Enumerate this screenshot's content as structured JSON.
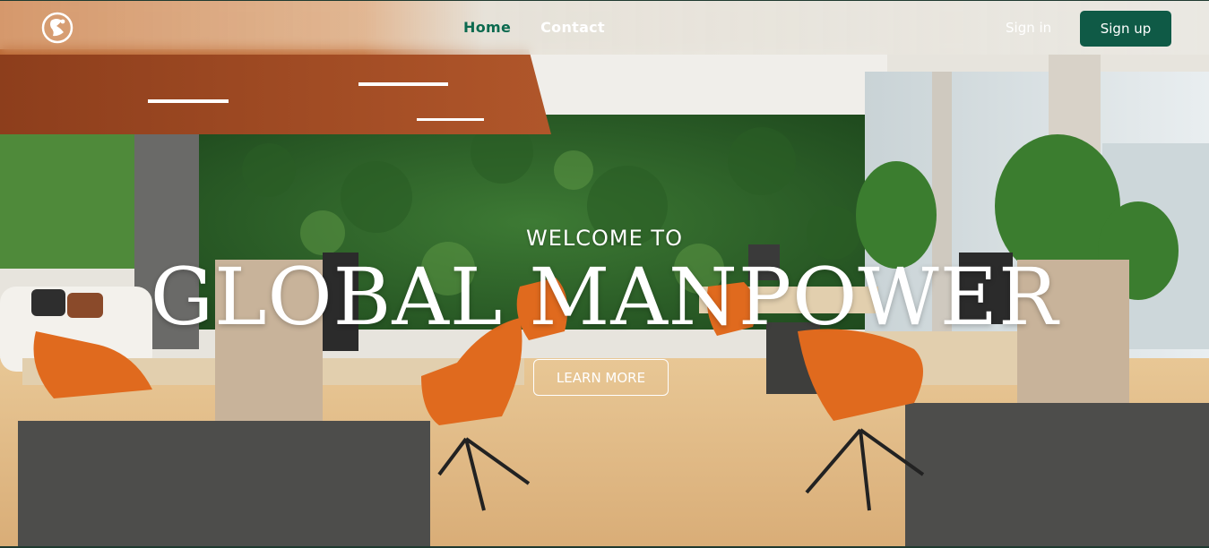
{
  "nav": {
    "logo_icon": "globe-runner-logo-icon",
    "links": [
      {
        "label": "Home",
        "active": true
      },
      {
        "label": "Contact",
        "active": false
      }
    ],
    "signin_label": "Sign in",
    "signup_label": "Sign up"
  },
  "hero": {
    "welcome": "WELCOME TO",
    "headline": "GLOBAL MANPOWER",
    "cta_label": "LEARN MORE",
    "background": "office-interior-photo"
  },
  "colors": {
    "brand_green": "#0f5a46",
    "active_link": "#0c6a4f",
    "text_on_image": "#ffffff"
  }
}
